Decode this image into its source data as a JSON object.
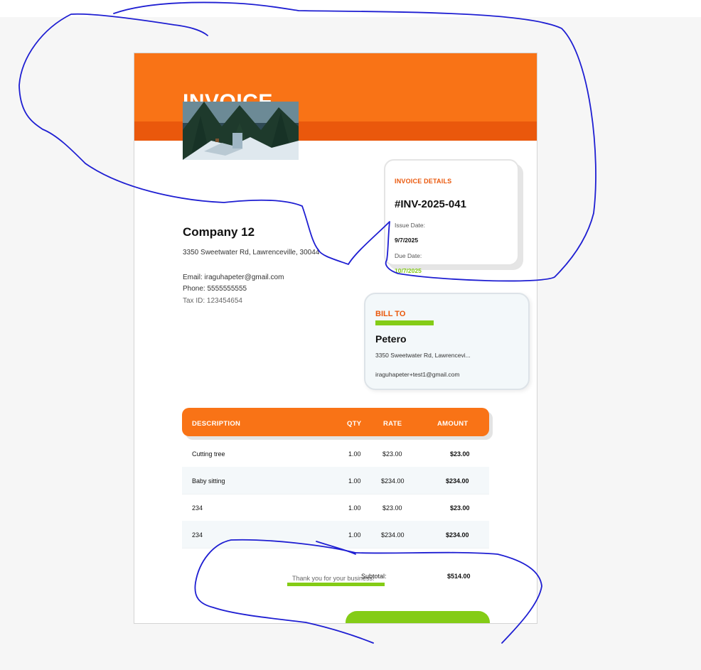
{
  "invoice": {
    "title": "INVOICE"
  },
  "company": {
    "name": "Company 12",
    "address": "3350 Sweetwater Rd, Lawrenceville, 30044",
    "email": "Email: iraguhapeter@gmail.com",
    "phone": "Phone: 5555555555",
    "tax_id": "Tax ID: 123454654"
  },
  "details": {
    "title": "INVOICE DETAILS",
    "number": "#INV-2025-041",
    "issue_label": "Issue Date:",
    "issue_date": "9/7/2025",
    "due_label": "Due Date:",
    "due_date": "10/7/2025"
  },
  "bill_to": {
    "title": "BILL TO",
    "name": "Petero",
    "address": "3350 Sweetwater Rd, Lawrencevi...",
    "email": "iraguhapeter+test1@gmail.com"
  },
  "table": {
    "headers": [
      "DESCRIPTION",
      "QTY",
      "RATE",
      "AMOUNT"
    ],
    "rows": [
      [
        "Cutting tree",
        "1.00",
        "$23.00",
        "$23.00"
      ],
      [
        "Baby sitting",
        "1.00",
        "$234.00",
        "$234.00"
      ],
      [
        "234",
        "1.00",
        "$23.00",
        "$23.00"
      ],
      [
        "234",
        "1.00",
        "$234.00",
        "$234.00"
      ]
    ]
  },
  "footer": {
    "thanks": "Thank you for your business!",
    "subtotal_label": "Subtotal:",
    "subtotal_value": "$514.00"
  },
  "colors": {
    "primary_orange": "#f97316",
    "dark_orange": "#ea580c",
    "accent_green": "#84cc16",
    "scribble_blue": "#1e1ed2"
  }
}
